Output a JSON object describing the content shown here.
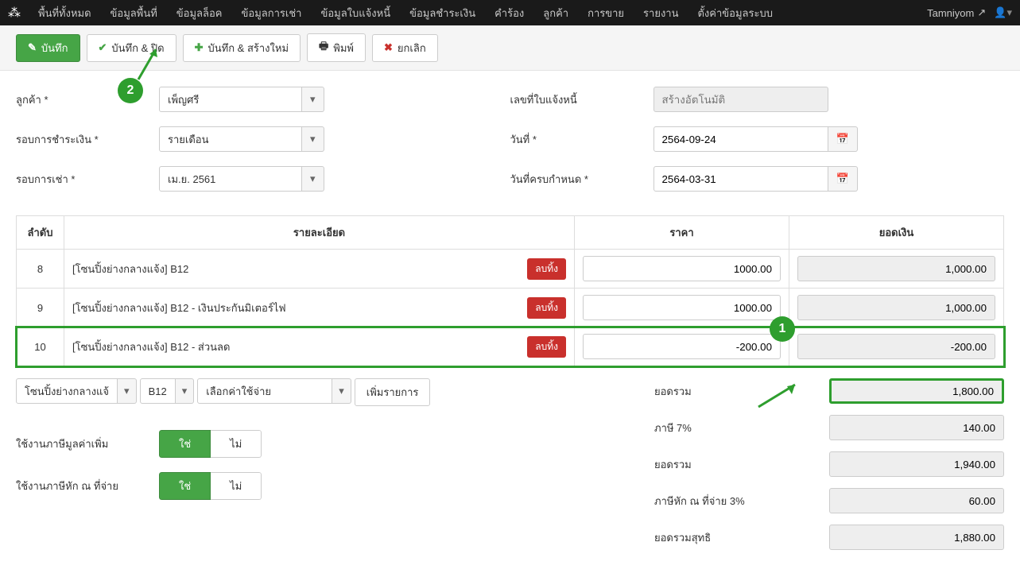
{
  "topnav": {
    "items": [
      "พื้นที่ทั้งหมด",
      "ข้อมูลพื้นที่",
      "ข้อมูลล็อค",
      "ข้อมูลการเช่า",
      "ข้อมูลใบแจ้งหนี้",
      "ข้อมูลชำระเงิน",
      "คำร้อง",
      "ลูกค้า",
      "การขาย",
      "รายงาน",
      "ตั้งค่าข้อมูลระบบ"
    ],
    "user": "Tamniyom"
  },
  "toolbar": {
    "save": "บันทึก",
    "save_close": "บันทึก & ปิด",
    "save_new": "บันทึก & สร้างใหม่",
    "print": "พิมพ์",
    "cancel": "ยกเลิก"
  },
  "form": {
    "customer_label": "ลูกค้า *",
    "customer_value": "เพ็ญศรี",
    "payment_cycle_label": "รอบการชำระเงิน *",
    "payment_cycle_value": "รายเดือน",
    "rent_cycle_label": "รอบการเช่า *",
    "rent_cycle_value": "เม.ย. 2561",
    "invoice_no_label": "เลขที่ใบแจ้งหนี้",
    "invoice_no_placeholder": "สร้างอัตโนมัติ",
    "date_label": "วันที่ *",
    "date_value": "2564-09-24",
    "due_label": "วันที่ครบกำหนด *",
    "due_value": "2564-03-31"
  },
  "table": {
    "headers": {
      "seq": "ลำดับ",
      "desc": "รายละเอียด",
      "price": "ราคา",
      "amount": "ยอดเงิน"
    },
    "delete_label": "ลบทิ้ง",
    "rows": [
      {
        "seq": "8",
        "desc": "[โซนปิ้งย่างกลางแจ้ง] B12",
        "price": "1000.00",
        "amount": "1,000.00"
      },
      {
        "seq": "9",
        "desc": "[โซนปิ้งย่างกลางแจ้ง] B12 - เงินประกันมิเตอร์ไฟ",
        "price": "1000.00",
        "amount": "1,000.00"
      },
      {
        "seq": "10",
        "desc": "[โซนปิ้งย่างกลางแจ้ง] B12 - ส่วนลด",
        "price": "-200.00",
        "amount": "-200.00"
      }
    ]
  },
  "add_row": {
    "zone": "โซนปิ้งย่างกลางแจ้",
    "lock": "B12",
    "expense": "เลือกค่าใช้จ่าย",
    "add_btn": "เพิ่มรายการ"
  },
  "toggles": {
    "vat_label": "ใช้งานภาษีมูลค่าเพิ่ม",
    "wht_label": "ใช้งานภาษีหัก ณ ที่จ่าย",
    "yes": "ใช่",
    "no": "ไม่"
  },
  "summary": {
    "subtotal_label": "ยอดรวม",
    "subtotal": "1,800.00",
    "vat_label": "ภาษี 7%",
    "vat": "140.00",
    "total_label": "ยอดรวม",
    "total": "1,940.00",
    "wht_label": "ภาษีหัก ณ ที่จ่าย 3%",
    "wht": "60.00",
    "net_label": "ยอดรวมสุทธิ",
    "net": "1,880.00"
  },
  "annotations": {
    "one": "1",
    "two": "2"
  }
}
